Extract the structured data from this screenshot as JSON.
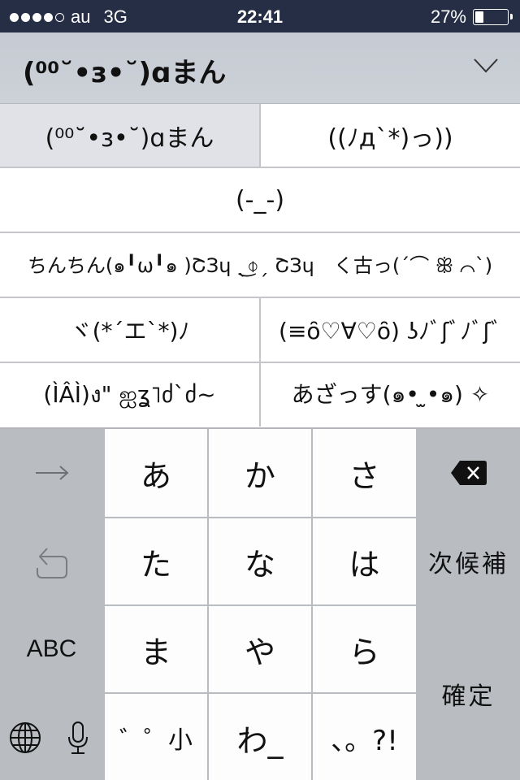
{
  "status_bar": {
    "signal_bars_filled": 4,
    "signal_bars_total": 5,
    "carrier": "au",
    "network": "3G",
    "time": "22:41",
    "battery_percent_label": "27%",
    "battery_level": 0.27
  },
  "candidate_header": {
    "selected_text": "(ʘ˘̴•з•˘̴)ɑまん",
    "expand_icon": "chevron-down-icon"
  },
  "candidates": [
    [
      "(⁰⁰˘•з•˘)ɑまん",
      "((ﾉд`*)っ))"
    ],
    [
      "(-_-)"
    ],
    [
      "ちんちん(๑╹ω╹๑ )ﾃﾞ3ﾝ ᕦ⍊ᕤ ﾃﾞ3ﾝ　く古っ(´⌒ꕥ⌒`)"
    ],
    [
      "ヾ(*´エ`*)ﾉ",
      "(≡ô꒳ô) ʖﾉﾞﾌﾉﾞ"
    ],
    [
      "(ÎÂÎ)ง\" ೪ʓ˥ძ`ძ~",
      "あ古っす(๑• ̫•๑) ✧"
    ]
  ],
  "candidate_labels": [
    [
      "(⁰⁰˘•з•˘)ɑまん",
      "((ﾉд`*)っ))"
    ],
    [
      "(-_-)"
    ],
    [
      "ちんちん(๑╹ω╹๑ )ՇЗɥ ˎ͜⌽ˏ ՇЗɥ　く古っ(´⌒ ꕥ ⌒`)"
    ],
    [
      "ヾ(*´エ`*)ﾉ",
      "(≡ȏ♡∀♡ȏ) ʖﾉﾞʃﾞﾉﾞʃﾞ"
    ],
    [
      "(ÌÂÌ)ง\" ஐʓ˥ძ`ძ~",
      "あざっす(๑• ̫•๑) ✧"
    ]
  ],
  "keyboard": {
    "next_arrow_icon": "arrow-right-icon",
    "undo_icon": "undo-icon",
    "abc_label": "ABC",
    "globe_icon": "globe-icon",
    "mic_icon": "microphone-icon",
    "delete_icon": "delete-icon",
    "next_candidate_label": "次候補",
    "confirm_label": "確定",
    "kana_keys": [
      "あ",
      "か",
      "さ",
      "た",
      "な",
      "は",
      "ま",
      "や",
      "ら",
      "゛゜小",
      "わ_",
      "、。?!"
    ]
  }
}
